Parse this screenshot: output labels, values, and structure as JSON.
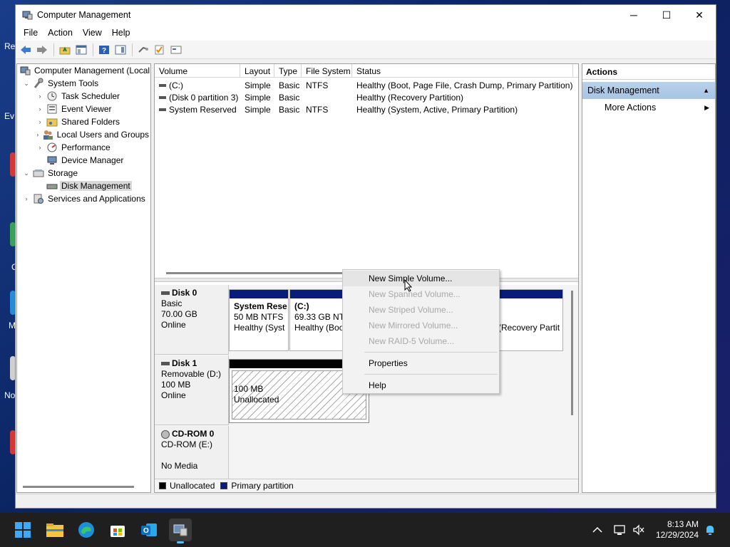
{
  "desktop": {
    "labels": [
      "Re",
      "Ev",
      "C",
      "M",
      "No"
    ]
  },
  "window": {
    "title": "Computer Management",
    "controls": {
      "minimize": "─",
      "maximize": "☐",
      "close": "✕"
    }
  },
  "menu": [
    "File",
    "Action",
    "View",
    "Help"
  ],
  "tree": {
    "root": "Computer Management (Local",
    "system_tools": "System Tools",
    "task_scheduler": "Task Scheduler",
    "event_viewer": "Event Viewer",
    "shared_folders": "Shared Folders",
    "local_users": "Local Users and Groups",
    "performance": "Performance",
    "device_manager": "Device Manager",
    "storage": "Storage",
    "disk_management": "Disk Management",
    "services": "Services and Applications"
  },
  "volumes": {
    "headers": [
      "Volume",
      "Layout",
      "Type",
      "File System",
      "Status"
    ],
    "rows": [
      {
        "volume": "(C:)",
        "layout": "Simple",
        "type": "Basic",
        "fs": "NTFS",
        "status": "Healthy (Boot, Page File, Crash Dump, Primary Partition)"
      },
      {
        "volume": "(Disk 0 partition 3)",
        "layout": "Simple",
        "type": "Basic",
        "fs": "",
        "status": "Healthy (Recovery Partition)"
      },
      {
        "volume": "System Reserved",
        "layout": "Simple",
        "type": "Basic",
        "fs": "NTFS",
        "status": "Healthy (System, Active, Primary Partition)"
      }
    ]
  },
  "disks": {
    "disk0": {
      "name": "Disk 0",
      "type": "Basic",
      "size": "70.00 GB",
      "state": "Online"
    },
    "disk0_parts": {
      "sysres": {
        "name": "System Rese",
        "size": "50 MB NTFS",
        "status": "Healthy (Syst"
      },
      "c": {
        "name": "(C:)",
        "size": "69.33 GB NTI",
        "status": "Healthy (Boo"
      },
      "recovery": {
        "status": "(Recovery Partit"
      }
    },
    "disk1": {
      "name": "Disk 1",
      "type": "Removable (D:)",
      "size": "100 MB",
      "state": "Online"
    },
    "disk1_part": {
      "size": "100 MB",
      "status": "Unallocated"
    },
    "cdrom": {
      "name": "CD-ROM 0",
      "type": "CD-ROM (E:)",
      "state": "No Media"
    },
    "legend": {
      "unallocated": "Unallocated",
      "primary": "Primary partition"
    },
    "colors": {
      "primary": "#0a1c7a",
      "unallocated": "#000000"
    }
  },
  "actions": {
    "header": "Actions",
    "section": "Disk Management",
    "more": "More Actions"
  },
  "context_menu": {
    "new_simple": "New Simple Volume...",
    "new_spanned": "New Spanned Volume...",
    "new_striped": "New Striped Volume...",
    "new_mirrored": "New Mirrored Volume...",
    "new_raid5": "New RAID-5 Volume...",
    "properties": "Properties",
    "help": "Help"
  },
  "taskbar": {
    "time": "8:13 AM",
    "date": "12/29/2024"
  }
}
